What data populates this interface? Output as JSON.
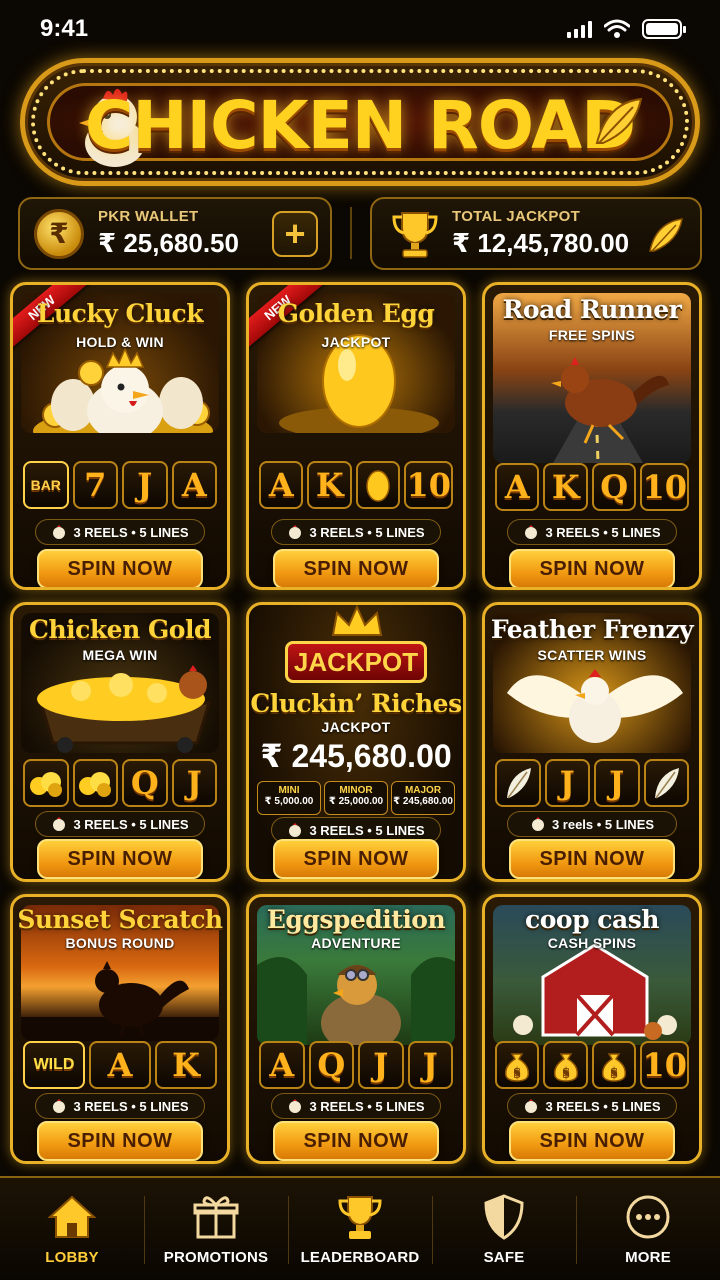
{
  "status_bar": {
    "time": "9:41"
  },
  "header": {
    "title": "CHICKEN ROAD"
  },
  "wallet": {
    "label": "PKR WALLET",
    "amount": "₹ 25,680.50",
    "currency_symbol": "₹",
    "add_label": "+"
  },
  "jackpot_total": {
    "label": "TOTAL JACKPOT",
    "amount": "₹ 12,45,780.00"
  },
  "games": [
    {
      "name": "Lucky Cluck",
      "subtitle": "HOLD & WIN",
      "badge": "NEW",
      "reels": [
        "BAR",
        "7",
        "J",
        "A"
      ],
      "info": "3 REELS • 5 LINES",
      "cta": "SPIN NOW"
    },
    {
      "name": "Golden Egg",
      "subtitle": "JACKPOT",
      "badge": "NEW",
      "reels": [
        "A",
        "K",
        "egg-icon",
        "10"
      ],
      "info": "3 REELS • 5 LINES",
      "cta": "SPIN NOW"
    },
    {
      "name": "Road Runner",
      "subtitle": "FREE SPINS",
      "reels": [
        "A",
        "K",
        "Q",
        "10"
      ],
      "info": "3 REELS • 5 LINES",
      "cta": "SPIN NOW"
    },
    {
      "name": "Chicken Gold",
      "subtitle": "MEGA WIN",
      "reels": [
        "gold-icon",
        "gold-icon",
        "Q",
        "J"
      ],
      "info": "3 REELS • 5 LINES",
      "cta": "SPIN NOW"
    },
    {
      "name": "Cluckin’ Riches",
      "subtitle": "JACKPOT",
      "banner": "JACKPOT",
      "amount": "₹ 245,680.00",
      "tiers": [
        {
          "label": "MINI",
          "value": "₹ 5,000.00"
        },
        {
          "label": "MINOR",
          "value": "₹ 25,000.00"
        },
        {
          "label": "MAJOR",
          "value": "₹ 245,680.00"
        }
      ],
      "info": "3 REELS • 5 LINES",
      "cta": "SPIN NOW"
    },
    {
      "name": "Feather Frenzy",
      "subtitle": "SCATTER WINS",
      "reels": [
        "feather-icon",
        "J",
        "J",
        "feather-icon"
      ],
      "info": "3 reels • 5 LINES",
      "cta": "SPIN NOW"
    },
    {
      "name": "Sunset Scratch",
      "subtitle": "BONUS ROUND",
      "reels": [
        "WILD",
        "A",
        "K"
      ],
      "info": "3 REELS • 5 LINES",
      "cta": "SPIN NOW"
    },
    {
      "name": "Eggspedition",
      "subtitle": "ADVENTURE",
      "reels": [
        "A",
        "Q",
        "J",
        "J"
      ],
      "info": "3 REELS • 5 LINES",
      "cta": "SPIN NOW"
    },
    {
      "name": "coop cash",
      "subtitle": "CASH SPINS",
      "reels": [
        "money-bag-icon",
        "money-bag-icon",
        "money-bag-icon",
        "10"
      ],
      "info": "3 REELS • 5 LINES",
      "cta": "SPIN NOW"
    }
  ],
  "nav": [
    {
      "label": "LOBBY",
      "icon": "home-icon",
      "active": true
    },
    {
      "label": "PROMOTIONS",
      "icon": "gift-icon"
    },
    {
      "label": "LEADERBOARD",
      "icon": "trophy-icon"
    },
    {
      "label": "SAFE",
      "icon": "shield-icon"
    },
    {
      "label": "MORE",
      "icon": "more-icon"
    }
  ],
  "colors": {
    "gold": "#ffd21f",
    "accent_orange": "#f29a12",
    "background": "#0b0702",
    "badge_red": "#d41515"
  }
}
